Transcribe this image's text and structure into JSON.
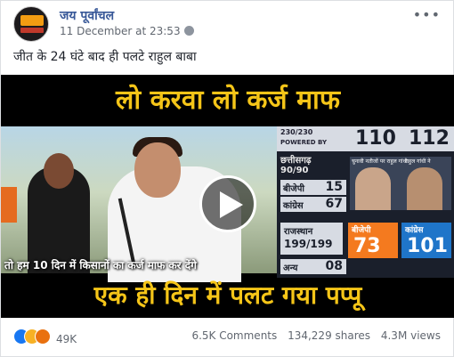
{
  "post": {
    "page_name": "जय पूर्वांचल",
    "timestamp": "11 December at 23:53",
    "caption": "जीत के 24 घंटे बाद ही पलटे राहुल बाबा"
  },
  "video": {
    "headline_top": "लो करवा लो कर्ज माफ",
    "headline_bottom": "एक ही दिन में पलट गया पप्पू",
    "subtitle": "तो हम 10 दिन में किसानों का कर्ज माफ कर देंगे",
    "results": {
      "top_left": "230/230",
      "powered_by": "POWERED BY",
      "score_1": "110",
      "score_2": "112",
      "state_1": "छत्तीसगढ़",
      "state_1_total": "90/90",
      "rows": [
        {
          "label": "बीजेपी",
          "value": "15"
        },
        {
          "label": "कांग्रेस",
          "value": "67"
        },
        {
          "label": "अन्य",
          "value": "08"
        }
      ],
      "candidate_caption_1": "चुनावी नतीजों पर राहुल गांधी",
      "candidate_caption_2": "राहुल गांधी ने",
      "state_2": "राजस्थान",
      "state_2_total": "199/199",
      "party_1": "बीजेपी",
      "party_1_value": "73",
      "party_2": "कांग्रेस",
      "party_2_value": "101"
    }
  },
  "stats": {
    "reaction_count": "49K",
    "comments": "6.5K Comments",
    "shares": "134,229 shares",
    "views": "4.3M views"
  },
  "icons": {
    "reactions": [
      "like-icon",
      "haha-icon",
      "angry-icon"
    ],
    "play": "play-icon"
  },
  "colors": {
    "page_link": "#385898",
    "headline": "#f5c518",
    "like": "#1877f2",
    "bjp": "#f47a1f",
    "congress": "#1f75c9"
  }
}
